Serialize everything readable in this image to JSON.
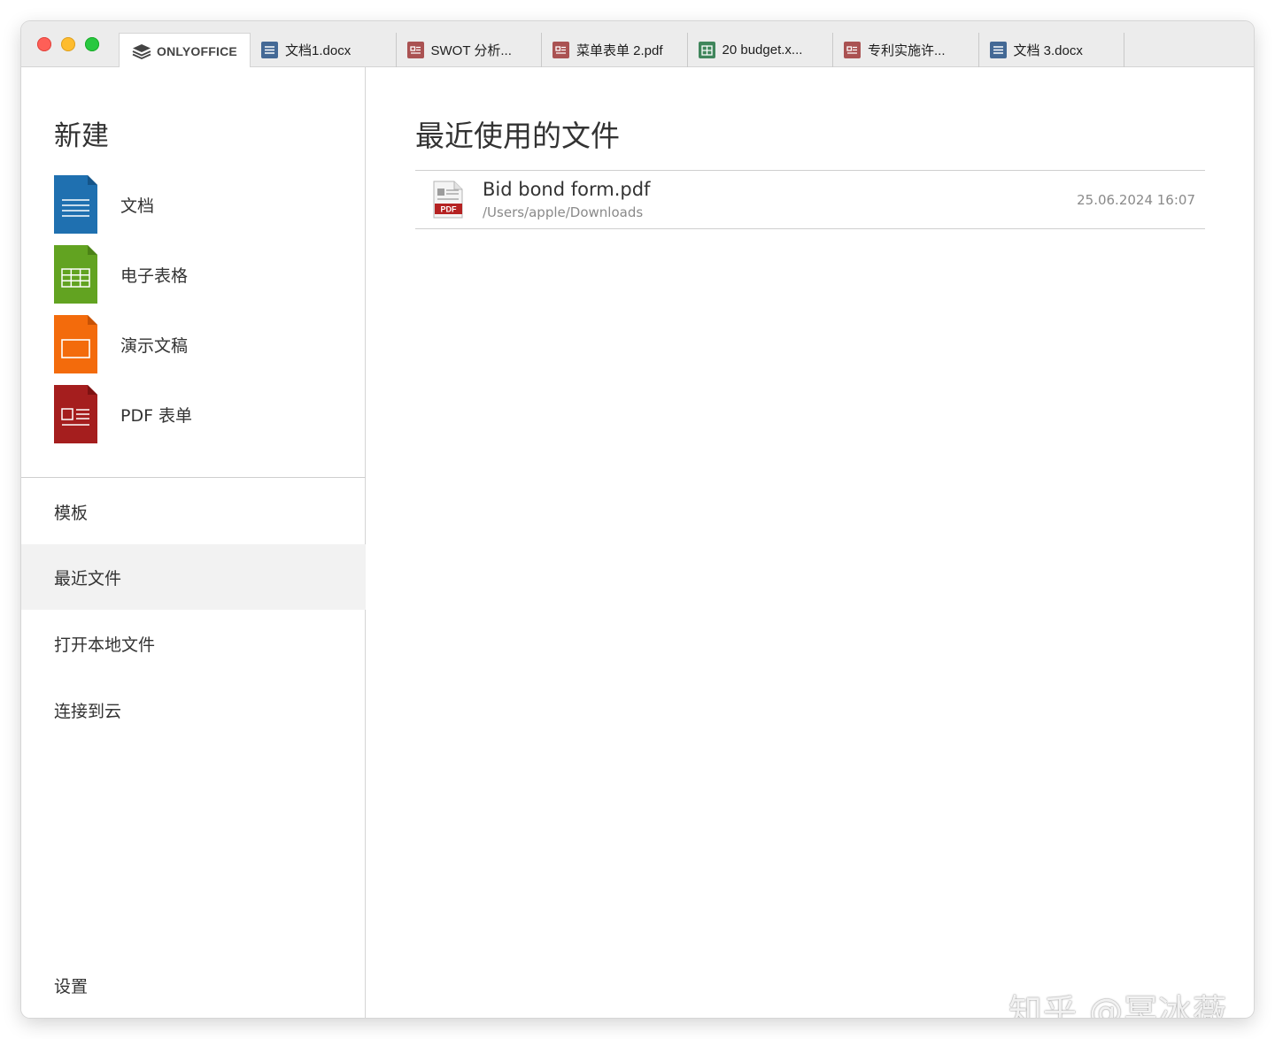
{
  "app": {
    "logo_text": "ONLYOFFICE",
    "logo_icon": "layers-icon"
  },
  "window_controls": [
    "close",
    "minimize",
    "maximize"
  ],
  "tabs": [
    {
      "label": "文档1.docx",
      "type": "doc"
    },
    {
      "label": "SWOT 分析...",
      "type": "pdf"
    },
    {
      "label": "菜单表单 2.pdf",
      "type": "pdf"
    },
    {
      "label": "20 budget.x...",
      "type": "xls"
    },
    {
      "label": "专利实施许...",
      "type": "pdf"
    },
    {
      "label": "文档 3.docx",
      "type": "doc"
    }
  ],
  "sidebar": {
    "new_title": "新建",
    "new_items": [
      {
        "label": "文档",
        "icon": "document-icon",
        "color": "#1f70b0"
      },
      {
        "label": "电子表格",
        "icon": "spreadsheet-icon",
        "color": "#62a321"
      },
      {
        "label": "演示文稿",
        "icon": "presentation-icon",
        "color": "#f36b0c"
      },
      {
        "label": "PDF 表单",
        "icon": "pdf-form-icon",
        "color": "#a51e1e"
      }
    ],
    "nav": [
      {
        "label": "模板",
        "active": false
      },
      {
        "label": "最近文件",
        "active": true
      },
      {
        "label": "打开本地文件",
        "active": false
      },
      {
        "label": "连接到云",
        "active": false
      }
    ],
    "settings_label": "设置"
  },
  "main": {
    "title": "最近使用的文件",
    "recent_files": [
      {
        "name": "Bid bond form.pdf",
        "path": "/Users/apple/Downloads",
        "date": "25.06.2024 16:07",
        "badge": "PDF"
      }
    ]
  },
  "watermark": "知乎 @冥冰薇"
}
